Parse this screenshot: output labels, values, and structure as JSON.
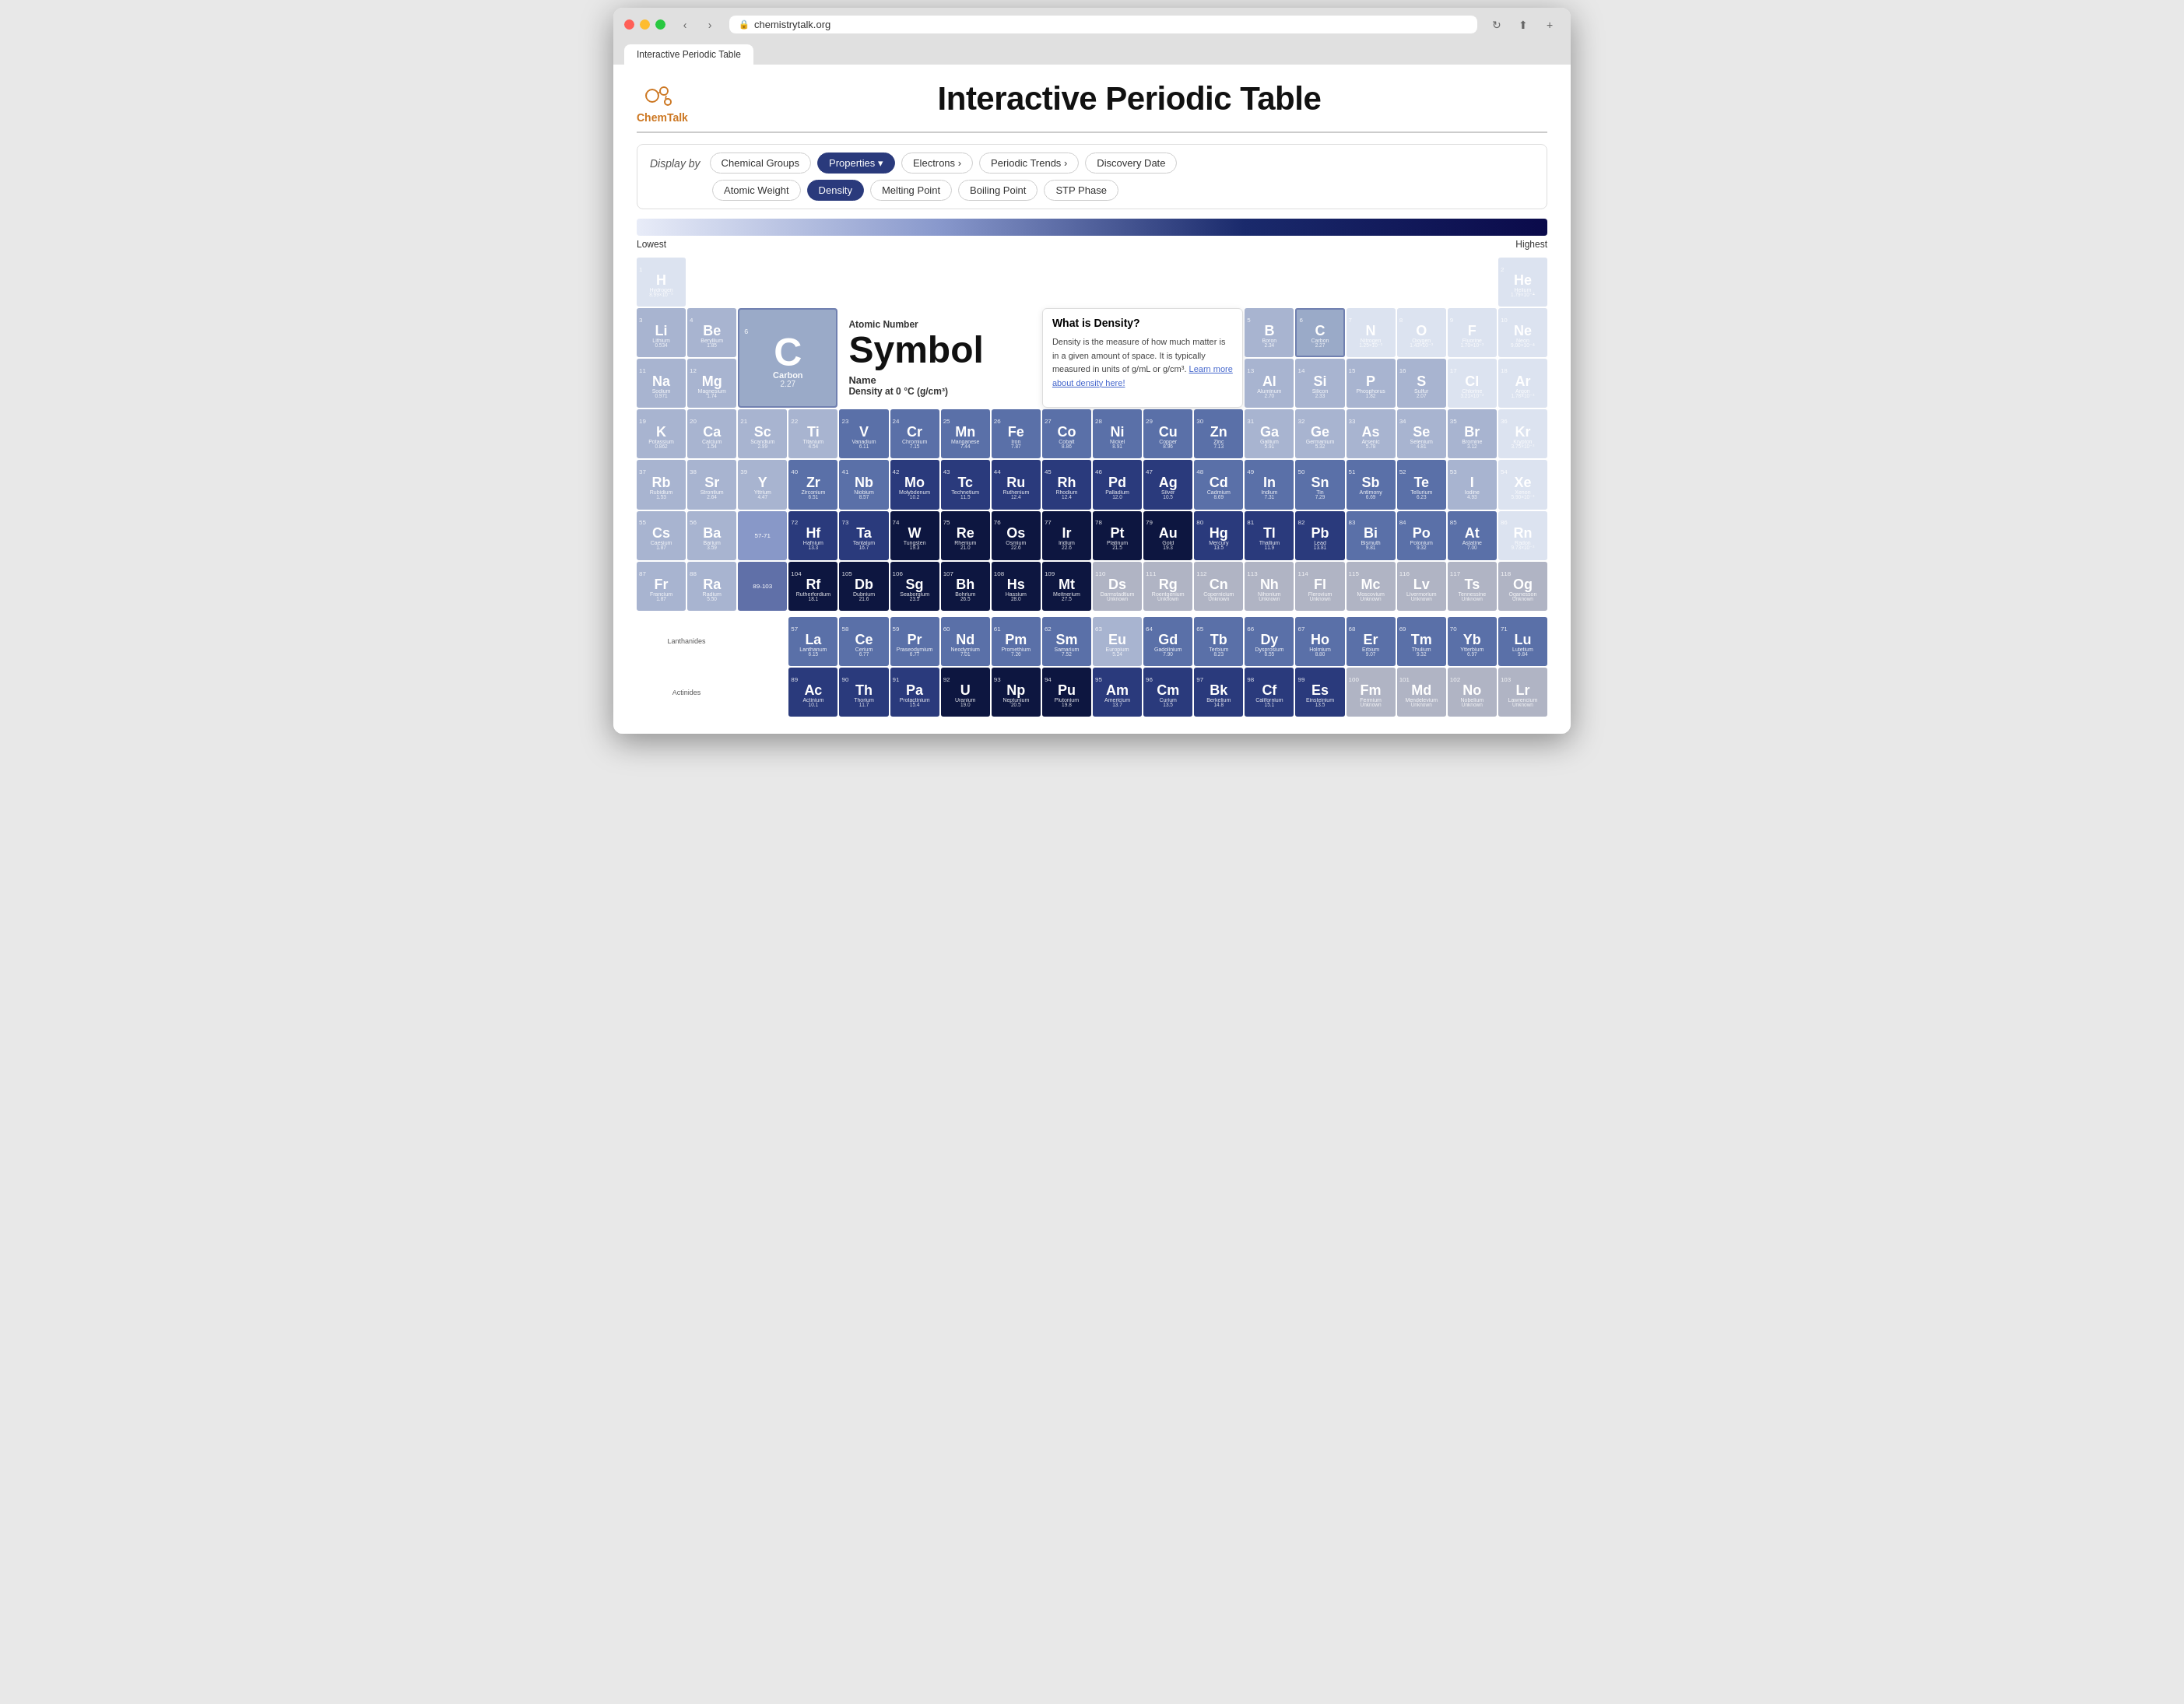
{
  "browser": {
    "url": "chemistrytalk.org",
    "tab_title": "Interactive Periodic Table"
  },
  "header": {
    "logo_text": "ChemTalk",
    "title": "Interactive Periodic Table"
  },
  "controls": {
    "display_by_label": "Display by",
    "row1_buttons": [
      {
        "label": "Chemical Groups",
        "active": false,
        "has_dropdown": false
      },
      {
        "label": "Properties",
        "active": true,
        "has_dropdown": true
      },
      {
        "label": "Electrons",
        "active": false,
        "has_dropdown": true
      },
      {
        "label": "Periodic Trends",
        "active": false,
        "has_dropdown": true
      },
      {
        "label": "Discovery Date",
        "active": false,
        "has_dropdown": false
      }
    ],
    "row2_buttons": [
      {
        "label": "Atomic Weight",
        "active": false
      },
      {
        "label": "Density",
        "active": true
      },
      {
        "label": "Melting Point",
        "active": false
      },
      {
        "label": "Boiling Point",
        "active": false
      },
      {
        "label": "STP Phase",
        "active": false
      }
    ]
  },
  "gradient": {
    "lowest_label": "Lowest",
    "highest_label": "Highest"
  },
  "selected_element": {
    "atomic_number": "6",
    "symbol": "C",
    "name": "Carbon",
    "density": "2.27",
    "atomic_number_label": "Atomic Number",
    "symbol_label": "Symbol",
    "name_label": "Name",
    "density_label": "Density at 0 °C (g/cm³)"
  },
  "info_popup": {
    "title": "What is Density?",
    "body": "Density is the measure of how much matter is in a given amount of space. It is typically measured in units of g/mL or g/cm³.",
    "link_text": "Learn more about density here!",
    "link_href": "#"
  },
  "elements": [
    {
      "num": "1",
      "sym": "H",
      "name": "Hydrogen",
      "d": "8.99×10⁻⁵",
      "col": 1,
      "row": 1,
      "dc": "d-lowest"
    },
    {
      "num": "2",
      "sym": "He",
      "name": "Helium",
      "d": "1.79×10⁻⁴",
      "col": 18,
      "row": 1,
      "dc": "d-lowest"
    },
    {
      "num": "3",
      "sym": "Li",
      "name": "Lithium",
      "d": "0.534",
      "col": 1,
      "row": 2,
      "dc": "d-low"
    },
    {
      "num": "4",
      "sym": "Be",
      "name": "Beryllium",
      "d": "1.85",
      "col": 2,
      "row": 2,
      "dc": "d-low"
    },
    {
      "num": "5",
      "sym": "B",
      "name": "Boron",
      "d": "2.34",
      "col": 13,
      "row": 2,
      "dc": "d-low"
    },
    {
      "num": "6",
      "sym": "C",
      "name": "Carbon",
      "d": "2.27",
      "col": 14,
      "row": 2,
      "dc": "d-selected"
    },
    {
      "num": "7",
      "sym": "N",
      "name": "Nitrogen",
      "d": "1.25×10⁻³",
      "col": 15,
      "row": 2,
      "dc": "d-lowest"
    },
    {
      "num": "8",
      "sym": "O",
      "name": "Oxygen",
      "d": "1.43×10⁻³",
      "col": 16,
      "row": 2,
      "dc": "d-lowest"
    },
    {
      "num": "9",
      "sym": "F",
      "name": "Fluorine",
      "d": "1.70×10⁻³",
      "col": 17,
      "row": 2,
      "dc": "d-lowest"
    },
    {
      "num": "10",
      "sym": "Ne",
      "name": "Neon",
      "d": "9.00×10⁻⁴",
      "col": 18,
      "row": 2,
      "dc": "d-lowest"
    },
    {
      "num": "11",
      "sym": "Na",
      "name": "Sodium",
      "d": "0.971",
      "col": 1,
      "row": 3,
      "dc": "d-low"
    },
    {
      "num": "12",
      "sym": "Mg",
      "name": "Magnesium",
      "d": "1.74",
      "col": 2,
      "row": 3,
      "dc": "d-low"
    },
    {
      "num": "13",
      "sym": "Al",
      "name": "Aluminum",
      "d": "2.70",
      "col": 13,
      "row": 3,
      "dc": "d-low"
    },
    {
      "num": "14",
      "sym": "Si",
      "name": "Silicon",
      "d": "2.33",
      "col": 14,
      "row": 3,
      "dc": "d-low"
    },
    {
      "num": "15",
      "sym": "P",
      "name": "Phosphorus",
      "d": "1.82",
      "col": 15,
      "row": 3,
      "dc": "d-low"
    },
    {
      "num": "16",
      "sym": "S",
      "name": "Sulfur",
      "d": "2.07",
      "col": 16,
      "row": 3,
      "dc": "d-low"
    },
    {
      "num": "17",
      "sym": "Cl",
      "name": "Chlorine",
      "d": "3.21×10⁻³",
      "col": 17,
      "row": 3,
      "dc": "d-lowest"
    },
    {
      "num": "18",
      "sym": "Ar",
      "name": "Argon",
      "d": "1.78×10⁻³",
      "col": 18,
      "row": 3,
      "dc": "d-lowest"
    },
    {
      "num": "19",
      "sym": "K",
      "name": "Potassium",
      "d": "0.862",
      "col": 1,
      "row": 4,
      "dc": "d-low"
    },
    {
      "num": "20",
      "sym": "Ca",
      "name": "Calcium",
      "d": "1.54",
      "col": 2,
      "row": 4,
      "dc": "d-low"
    },
    {
      "num": "21",
      "sym": "Sc",
      "name": "Scandium",
      "d": "2.99",
      "col": 3,
      "row": 4,
      "dc": "d-low"
    },
    {
      "num": "22",
      "sym": "Ti",
      "name": "Titanium",
      "d": "4.54",
      "col": 4,
      "row": 4,
      "dc": "d-low"
    },
    {
      "num": "23",
      "sym": "V",
      "name": "Vanadium",
      "d": "6.11",
      "col": 5,
      "row": 4,
      "dc": "d-mid"
    },
    {
      "num": "24",
      "sym": "Cr",
      "name": "Chromium",
      "d": "7.15",
      "col": 6,
      "row": 4,
      "dc": "d-mid"
    },
    {
      "num": "25",
      "sym": "Mn",
      "name": "Manganese",
      "d": "7.44",
      "col": 7,
      "row": 4,
      "dc": "d-mid"
    },
    {
      "num": "26",
      "sym": "Fe",
      "name": "Iron",
      "d": "7.87",
      "col": 8,
      "row": 4,
      "dc": "d-mid"
    },
    {
      "num": "27",
      "sym": "Co",
      "name": "Cobalt",
      "d": "8.86",
      "col": 9,
      "row": 4,
      "dc": "d-mid"
    },
    {
      "num": "28",
      "sym": "Ni",
      "name": "Nickel",
      "d": "8.91",
      "col": 10,
      "row": 4,
      "dc": "d-mid"
    },
    {
      "num": "29",
      "sym": "Cu",
      "name": "Copper",
      "d": "8.96",
      "col": 11,
      "row": 4,
      "dc": "d-mid"
    },
    {
      "num": "30",
      "sym": "Zn",
      "name": "Zinc",
      "d": "7.13",
      "col": 12,
      "row": 4,
      "dc": "d-mid"
    },
    {
      "num": "31",
      "sym": "Ga",
      "name": "Gallium",
      "d": "5.91",
      "col": 13,
      "row": 4,
      "dc": "d-low"
    },
    {
      "num": "32",
      "sym": "Ge",
      "name": "Germanium",
      "d": "5.32",
      "col": 14,
      "row": 4,
      "dc": "d-low"
    },
    {
      "num": "33",
      "sym": "As",
      "name": "Arsenic",
      "d": "5.78",
      "col": 15,
      "row": 4,
      "dc": "d-low"
    },
    {
      "num": "34",
      "sym": "Se",
      "name": "Selenium",
      "d": "4.81",
      "col": 16,
      "row": 4,
      "dc": "d-low"
    },
    {
      "num": "35",
      "sym": "Br",
      "name": "Bromine",
      "d": "3.12",
      "col": 17,
      "row": 4,
      "dc": "d-low"
    },
    {
      "num": "36",
      "sym": "Kr",
      "name": "Krypton",
      "d": "3.75×10⁻³",
      "col": 18,
      "row": 4,
      "dc": "d-lowest"
    },
    {
      "num": "37",
      "sym": "Rb",
      "name": "Rubidium",
      "d": "1.53",
      "col": 1,
      "row": 5,
      "dc": "d-low"
    },
    {
      "num": "38",
      "sym": "Sr",
      "name": "Strontium",
      "d": "2.64",
      "col": 2,
      "row": 5,
      "dc": "d-low"
    },
    {
      "num": "39",
      "sym": "Y",
      "name": "Yttrium",
      "d": "4.47",
      "col": 3,
      "row": 5,
      "dc": "d-low"
    },
    {
      "num": "40",
      "sym": "Zr",
      "name": "Zirconium",
      "d": "6.51",
      "col": 4,
      "row": 5,
      "dc": "d-mid"
    },
    {
      "num": "41",
      "sym": "Nb",
      "name": "Niobium",
      "d": "8.57",
      "col": 5,
      "row": 5,
      "dc": "d-mid"
    },
    {
      "num": "42",
      "sym": "Mo",
      "name": "Molybdenum",
      "d": "10.2",
      "col": 6,
      "row": 5,
      "dc": "d-high"
    },
    {
      "num": "43",
      "sym": "Tc",
      "name": "Technetium",
      "d": "11.5",
      "col": 7,
      "row": 5,
      "dc": "d-high"
    },
    {
      "num": "44",
      "sym": "Ru",
      "name": "Ruthenium",
      "d": "12.4",
      "col": 8,
      "row": 5,
      "dc": "d-high"
    },
    {
      "num": "45",
      "sym": "Rh",
      "name": "Rhodium",
      "d": "12.4",
      "col": 9,
      "row": 5,
      "dc": "d-high"
    },
    {
      "num": "46",
      "sym": "Pd",
      "name": "Palladium",
      "d": "12.0",
      "col": 10,
      "row": 5,
      "dc": "d-high"
    },
    {
      "num": "47",
      "sym": "Ag",
      "name": "Silver",
      "d": "10.5",
      "col": 11,
      "row": 5,
      "dc": "d-high"
    },
    {
      "num": "48",
      "sym": "Cd",
      "name": "Cadmium",
      "d": "8.69",
      "col": 12,
      "row": 5,
      "dc": "d-mid"
    },
    {
      "num": "49",
      "sym": "In",
      "name": "Indium",
      "d": "7.31",
      "col": 13,
      "row": 5,
      "dc": "d-mid"
    },
    {
      "num": "50",
      "sym": "Sn",
      "name": "Tin",
      "d": "7.29",
      "col": 14,
      "row": 5,
      "dc": "d-mid"
    },
    {
      "num": "51",
      "sym": "Sb",
      "name": "Antimony",
      "d": "6.69",
      "col": 15,
      "row": 5,
      "dc": "d-mid"
    },
    {
      "num": "52",
      "sym": "Te",
      "name": "Tellurium",
      "d": "6.23",
      "col": 16,
      "row": 5,
      "dc": "d-mid"
    },
    {
      "num": "53",
      "sym": "I",
      "name": "Iodine",
      "d": "4.93",
      "col": 17,
      "row": 5,
      "dc": "d-low"
    },
    {
      "num": "54",
      "sym": "Xe",
      "name": "Xenon",
      "d": "5.90×10⁻³",
      "col": 18,
      "row": 5,
      "dc": "d-lowest"
    },
    {
      "num": "55",
      "sym": "Cs",
      "name": "Caesium",
      "d": "1.87",
      "col": 1,
      "row": 6,
      "dc": "d-low"
    },
    {
      "num": "56",
      "sym": "Ba",
      "name": "Barium",
      "d": "3.59",
      "col": 2,
      "row": 6,
      "dc": "d-low"
    },
    {
      "num": "72",
      "sym": "Hf",
      "name": "Hafnium",
      "d": "13.3",
      "col": 4,
      "row": 6,
      "dc": "d-high"
    },
    {
      "num": "73",
      "sym": "Ta",
      "name": "Tantalum",
      "d": "16.7",
      "col": 5,
      "row": 6,
      "dc": "d-high"
    },
    {
      "num": "74",
      "sym": "W",
      "name": "Tungsten",
      "d": "19.3",
      "col": 6,
      "row": 6,
      "dc": "d-highest"
    },
    {
      "num": "75",
      "sym": "Re",
      "name": "Rhenium",
      "d": "21.0",
      "col": 7,
      "row": 6,
      "dc": "d-highest"
    },
    {
      "num": "76",
      "sym": "Os",
      "name": "Osmium",
      "d": "22.6",
      "col": 8,
      "row": 6,
      "dc": "d-highest"
    },
    {
      "num": "77",
      "sym": "Ir",
      "name": "Iridium",
      "d": "22.6",
      "col": 9,
      "row": 6,
      "dc": "d-highest"
    },
    {
      "num": "78",
      "sym": "Pt",
      "name": "Platinum",
      "d": "21.5",
      "col": 10,
      "row": 6,
      "dc": "d-highest"
    },
    {
      "num": "79",
      "sym": "Au",
      "name": "Gold",
      "d": "19.3",
      "col": 11,
      "row": 6,
      "dc": "d-highest"
    },
    {
      "num": "80",
      "sym": "Hg",
      "name": "Mercury",
      "d": "13.5",
      "col": 12,
      "row": 6,
      "dc": "d-high"
    },
    {
      "num": "81",
      "sym": "Tl",
      "name": "Thallium",
      "d": "11.9",
      "col": 13,
      "row": 6,
      "dc": "d-high"
    },
    {
      "num": "82",
      "sym": "Pb",
      "name": "Lead",
      "d": "13.81",
      "col": 14,
      "row": 6,
      "dc": "d-high"
    },
    {
      "num": "83",
      "sym": "Bi",
      "name": "Bismuth",
      "d": "9.81",
      "col": 15,
      "row": 6,
      "dc": "d-mid"
    },
    {
      "num": "84",
      "sym": "Po",
      "name": "Polonium",
      "d": "9.32",
      "col": 16,
      "row": 6,
      "dc": "d-mid"
    },
    {
      "num": "85",
      "sym": "At",
      "name": "Astatine",
      "d": "7.00",
      "col": 17,
      "row": 6,
      "dc": "d-mid"
    },
    {
      "num": "86",
      "sym": "Rn",
      "name": "Radon",
      "d": "9.73×10⁻³",
      "col": 18,
      "row": 6,
      "dc": "d-lowest"
    },
    {
      "num": "87",
      "sym": "Fr",
      "name": "Francium",
      "d": "1.87",
      "col": 1,
      "row": 7,
      "dc": "d-low"
    },
    {
      "num": "88",
      "sym": "Ra",
      "name": "Radium",
      "d": "5.50",
      "col": 2,
      "row": 7,
      "dc": "d-low"
    },
    {
      "num": "104",
      "sym": "Rf",
      "name": "Rutherfordium",
      "d": "18.1",
      "col": 4,
      "row": 7,
      "dc": "d-highest"
    },
    {
      "num": "105",
      "sym": "Db",
      "name": "Dubnium",
      "d": "21.6",
      "col": 5,
      "row": 7,
      "dc": "d-highest"
    },
    {
      "num": "106",
      "sym": "Sg",
      "name": "Seaborgium",
      "d": "23.5",
      "col": 6,
      "row": 7,
      "dc": "d-highest"
    },
    {
      "num": "107",
      "sym": "Bh",
      "name": "Bohrium",
      "d": "26.5",
      "col": 7,
      "row": 7,
      "dc": "d-highest"
    },
    {
      "num": "108",
      "sym": "Hs",
      "name": "Hassium",
      "d": "28.0",
      "col": 8,
      "row": 7,
      "dc": "d-highest"
    },
    {
      "num": "109",
      "sym": "Mt",
      "name": "Meitnerium",
      "d": "27.5",
      "col": 9,
      "row": 7,
      "dc": "d-highest"
    },
    {
      "num": "110",
      "sym": "Ds",
      "name": "Darmstadtium",
      "d": "Unknown",
      "col": 10,
      "row": 7,
      "dc": "d-unknown"
    },
    {
      "num": "111",
      "sym": "Rg",
      "name": "Roentgenium",
      "d": "Unknown",
      "col": 11,
      "row": 7,
      "dc": "d-unknown"
    },
    {
      "num": "112",
      "sym": "Cn",
      "name": "Copernicium",
      "d": "Unknown",
      "col": 12,
      "row": 7,
      "dc": "d-unknown"
    },
    {
      "num": "113",
      "sym": "Nh",
      "name": "Nihonium",
      "d": "Unknown",
      "col": 13,
      "row": 7,
      "dc": "d-unknown"
    },
    {
      "num": "114",
      "sym": "Fl",
      "name": "Flerovium",
      "d": "Unknown",
      "col": 14,
      "row": 7,
      "dc": "d-unknown"
    },
    {
      "num": "115",
      "sym": "Mc",
      "name": "Moscovium",
      "d": "Unknown",
      "col": 15,
      "row": 7,
      "dc": "d-unknown"
    },
    {
      "num": "116",
      "sym": "Lv",
      "name": "Livermorium",
      "d": "Unknown",
      "col": 16,
      "row": 7,
      "dc": "d-unknown"
    },
    {
      "num": "117",
      "sym": "Ts",
      "name": "Tennessine",
      "d": "Unknown",
      "col": 17,
      "row": 7,
      "dc": "d-unknown"
    },
    {
      "num": "118",
      "sym": "Og",
      "name": "Oganesson",
      "d": "Unknown",
      "col": 18,
      "row": 7,
      "dc": "d-unknown"
    }
  ],
  "lanthanides": [
    {
      "num": "57",
      "sym": "La",
      "name": "Lanthanum",
      "d": "6.15",
      "dc": "d-mid"
    },
    {
      "num": "58",
      "sym": "Ce",
      "name": "Cerium",
      "d": "6.77",
      "dc": "d-mid"
    },
    {
      "num": "59",
      "sym": "Pr",
      "name": "Praseodymium",
      "d": "6.77",
      "dc": "d-mid"
    },
    {
      "num": "60",
      "sym": "Nd",
      "name": "Neodymium",
      "d": "7.01",
      "dc": "d-mid"
    },
    {
      "num": "61",
      "sym": "Pm",
      "name": "Promethium",
      "d": "7.26",
      "dc": "d-mid"
    },
    {
      "num": "62",
      "sym": "Sm",
      "name": "Samarium",
      "d": "7.52",
      "dc": "d-mid"
    },
    {
      "num": "63",
      "sym": "Eu",
      "name": "Europium",
      "d": "5.24",
      "dc": "d-low"
    },
    {
      "num": "64",
      "sym": "Gd",
      "name": "Gadolinium",
      "d": "7.90",
      "dc": "d-mid"
    },
    {
      "num": "65",
      "sym": "Tb",
      "name": "Terbium",
      "d": "8.23",
      "dc": "d-mid"
    },
    {
      "num": "66",
      "sym": "Dy",
      "name": "Dysprosium",
      "d": "8.55",
      "dc": "d-mid"
    },
    {
      "num": "67",
      "sym": "Ho",
      "name": "Holmium",
      "d": "8.80",
      "dc": "d-mid"
    },
    {
      "num": "68",
      "sym": "Er",
      "name": "Erbium",
      "d": "9.07",
      "dc": "d-mid"
    },
    {
      "num": "69",
      "sym": "Tm",
      "name": "Thulium",
      "d": "9.32",
      "dc": "d-mid"
    },
    {
      "num": "70",
      "sym": "Yb",
      "name": "Ytterbium",
      "d": "6.97",
      "dc": "d-mid"
    },
    {
      "num": "71",
      "sym": "Lu",
      "name": "Lutetium",
      "d": "9.84",
      "dc": "d-mid"
    }
  ],
  "actinides": [
    {
      "num": "89",
      "sym": "Ac",
      "name": "Actinium",
      "d": "10.1",
      "dc": "d-high"
    },
    {
      "num": "90",
      "sym": "Th",
      "name": "Thorium",
      "d": "11.7",
      "dc": "d-high"
    },
    {
      "num": "91",
      "sym": "Pa",
      "name": "Protactinium",
      "d": "15.4",
      "dc": "d-high"
    },
    {
      "num": "92",
      "sym": "U",
      "name": "Uranium",
      "d": "19.0",
      "dc": "d-highest"
    },
    {
      "num": "93",
      "sym": "Np",
      "name": "Neptunium",
      "d": "20.5",
      "dc": "d-highest"
    },
    {
      "num": "94",
      "sym": "Pu",
      "name": "Plutonium",
      "d": "19.8",
      "dc": "d-highest"
    },
    {
      "num": "95",
      "sym": "Am",
      "name": "Americium",
      "d": "13.7",
      "dc": "d-high"
    },
    {
      "num": "96",
      "sym": "Cm",
      "name": "Curium",
      "d": "13.5",
      "dc": "d-high"
    },
    {
      "num": "97",
      "sym": "Bk",
      "name": "Berkelium",
      "d": "14.8",
      "dc": "d-high"
    },
    {
      "num": "98",
      "sym": "Cf",
      "name": "Californium",
      "d": "15.1",
      "dc": "d-high"
    },
    {
      "num": "99",
      "sym": "Es",
      "name": "Einsteinium",
      "d": "13.5",
      "dc": "d-high"
    },
    {
      "num": "100",
      "sym": "Fm",
      "name": "Fermium",
      "d": "Unknown",
      "dc": "d-unknown"
    },
    {
      "num": "101",
      "sym": "Md",
      "name": "Mendelevium",
      "d": "Unknown",
      "dc": "d-unknown"
    },
    {
      "num": "102",
      "sym": "No",
      "name": "Nobelium",
      "d": "Unknown",
      "dc": "d-unknown"
    },
    {
      "num": "103",
      "sym": "Lr",
      "name": "Lawrencium",
      "d": "Unknown",
      "dc": "d-unknown"
    }
  ]
}
